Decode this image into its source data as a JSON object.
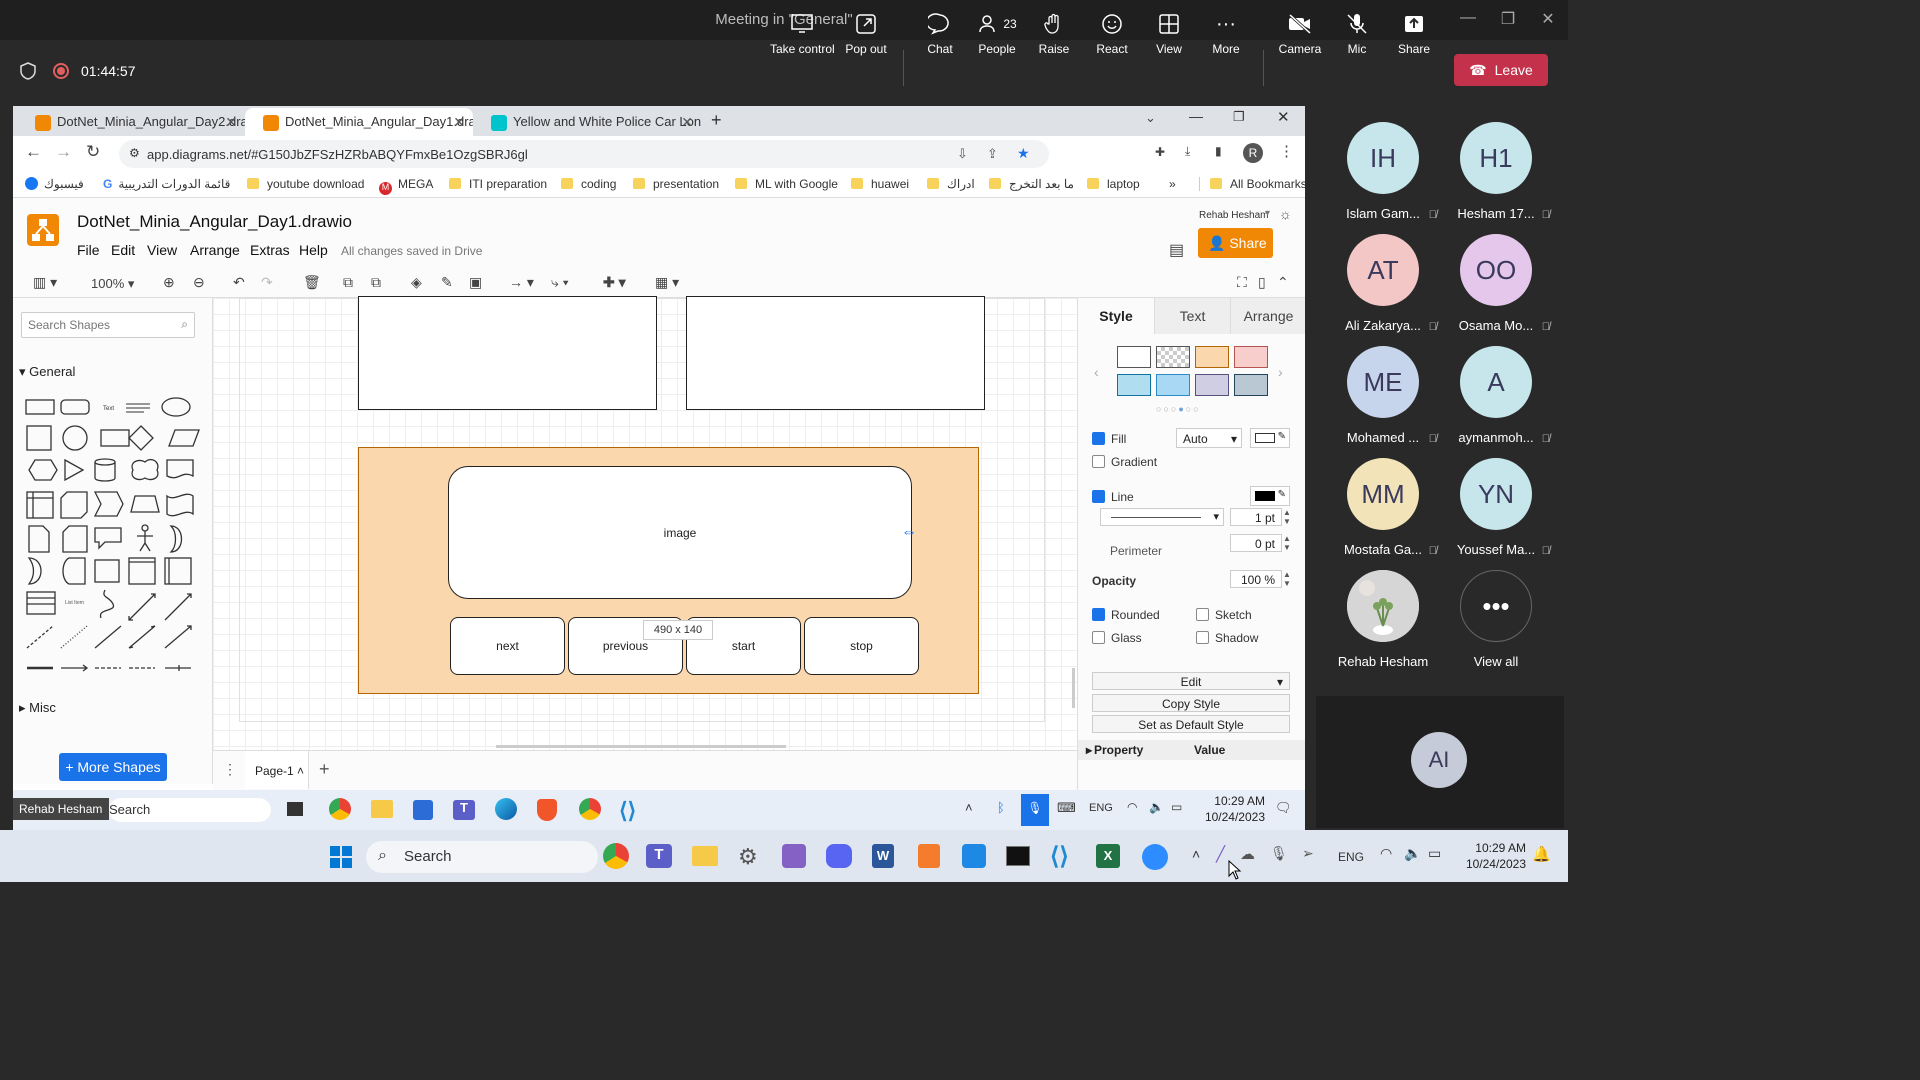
{
  "teams": {
    "window_title": "Meeting in \"General\"",
    "timer": "01:44:57",
    "toolbar": [
      {
        "label": "Take control",
        "icon": "take-control-icon"
      },
      {
        "label": "Pop out",
        "icon": "pop-out-icon"
      },
      {
        "label": "Chat",
        "icon": "chat-icon"
      },
      {
        "label": "People",
        "icon": "people-icon",
        "count": "23"
      },
      {
        "label": "Raise",
        "icon": "raise-hand-icon"
      },
      {
        "label": "React",
        "icon": "react-icon"
      },
      {
        "label": "View",
        "icon": "view-icon"
      },
      {
        "label": "More",
        "icon": "more-icon"
      },
      {
        "label": "Camera",
        "icon": "camera-off-icon"
      },
      {
        "label": "Mic",
        "icon": "mic-off-icon"
      },
      {
        "label": "Share",
        "icon": "share-icon"
      }
    ],
    "leave_label": "Leave",
    "participants": [
      {
        "initials": "IH",
        "name": "Islam Gam...",
        "color": "#c7e6ec"
      },
      {
        "initials": "H1",
        "name": "Hesham 17...",
        "color": "#c7e6ec"
      },
      {
        "initials": "AT",
        "name": "Ali Zakarya...",
        "color": "#f4c7c7"
      },
      {
        "initials": "OO",
        "name": "Osama Mo...",
        "color": "#e6c7ec"
      },
      {
        "initials": "ME",
        "name": "Mohamed ...",
        "color": "#c7d5ec"
      },
      {
        "initials": "A",
        "name": "aymanmoh...",
        "color": "#c7e6ec"
      },
      {
        "initials": "MM",
        "name": "Mostafa Ga...",
        "color": "#f2e4b8"
      },
      {
        "initials": "YN",
        "name": "Youssef Ma...",
        "color": "#c7e6ec"
      },
      {
        "initials": "",
        "name": "Rehab Hesham",
        "color": "#d9d9d9"
      },
      {
        "initials": "•••",
        "name": "View all",
        "color": "#292929"
      }
    ],
    "ai_tile": "AI",
    "presenter_label": "Rehab Hesham"
  },
  "browser": {
    "tabs": [
      {
        "title": "DotNet_Minia_Angular_Day2.dra",
        "color": "#f08705"
      },
      {
        "title": "DotNet_Minia_Angular_Day1.dra",
        "color": "#f08705",
        "active": true
      },
      {
        "title": "Yellow and White Police Car Lon",
        "color": "#00c4cc"
      }
    ],
    "url": "app.diagrams.net/#G150JbZFSzHZRbABQYFmxBe1OzgSBRJ6gl",
    "profile_initial": "R",
    "bookmarks": [
      "فيسبوك",
      "قائمة الدورات التدريبية",
      "youtube download",
      "MEGA",
      "ITI preparation",
      "coding",
      "presentation",
      "ML with Google",
      "huawei",
      "ادراك",
      "ما بعد التخرج",
      "laptop",
      "»",
      "All Bookmarks"
    ]
  },
  "drawio": {
    "file_title": "DotNet_Minia_Angular_Day1.drawio",
    "menus": [
      "File",
      "Edit",
      "View",
      "Arrange",
      "Extras",
      "Help"
    ],
    "save_status": "All changes saved in Drive",
    "user": "Rehab Hesham",
    "share_label": "Share",
    "zoom": "100%",
    "search_placeholder": "Search Shapes",
    "sections": [
      "General",
      "Misc"
    ],
    "more_shapes": "+ More Shapes",
    "page_tab": "Page-1",
    "diagram": {
      "image_label": "image",
      "buttons": [
        "next",
        "previous",
        "start",
        "stop"
      ],
      "size_tooltip": "490 x 140"
    },
    "format": {
      "tabs": [
        "Style",
        "Text",
        "Arrange"
      ],
      "swatches": [
        "#ffffff",
        "checker",
        "#fad7ac",
        "#f8cecc",
        "#b1ddf0",
        "#a9d8f5",
        "#d0cee2",
        "#bac8d3"
      ],
      "fill_label": "Fill",
      "fill_value": "Auto",
      "gradient_label": "Gradient",
      "line_label": "Line",
      "line_width": "1 pt",
      "perimeter_label": "Perimeter",
      "perimeter_value": "0 pt",
      "opacity_label": "Opacity",
      "opacity_value": "100 %",
      "rounded_label": "Rounded",
      "sketch_label": "Sketch",
      "glass_label": "Glass",
      "shadow_label": "Shadow",
      "edit_label": "Edit",
      "copy_style": "Copy Style",
      "default_style": "Set as Default Style",
      "property_header": "Property",
      "value_header": "Value"
    }
  },
  "windows_inner": {
    "search": "Search",
    "lang": "ENG",
    "time": "10:29 AM",
    "date": "10/24/2023"
  },
  "windows_host": {
    "search": "Search",
    "lang": "ENG",
    "time": "10:29 AM",
    "date": "10/24/2023"
  }
}
